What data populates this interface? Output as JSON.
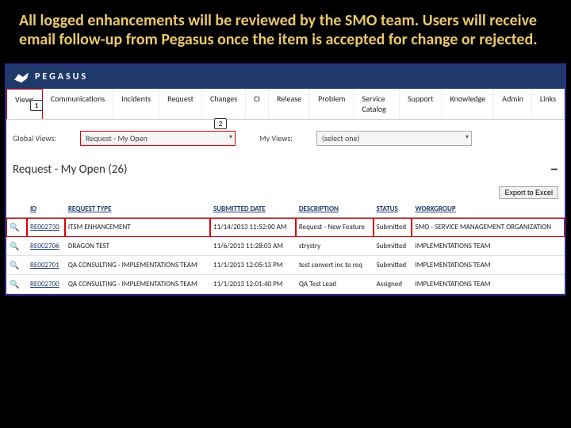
{
  "header": "All logged enhancements will be reviewed by the SMO team. Users will receive email follow-up from Pegasus once the item is accepted for change or rejected.",
  "brand": "PEGASUS",
  "tabs": [
    "Views",
    "Communications",
    "Incidents",
    "Request",
    "Changes",
    "CI",
    "Release",
    "Problem",
    "Service Catalog",
    "Support",
    "Knowledge",
    "Admin",
    "Links"
  ],
  "callouts": {
    "c1": "1",
    "c2": "2"
  },
  "filters": {
    "global_label": "Global Views:",
    "global_value": "Request - My Open",
    "my_label": "My Views:",
    "my_value": "(select one)"
  },
  "section": {
    "title": "Request - My Open",
    "count": "(26)"
  },
  "export_btn": "Export to Excel",
  "columns": [
    "",
    "ID",
    "REQUEST TYPE",
    "SUBMITTED DATE",
    "DESCRIPTION",
    "STATUS",
    "WORKGROUP"
  ],
  "rows": [
    {
      "id": "RE002730",
      "type": "ITSM ENHANCEMENT",
      "date": "11/14/2013 11:52:00 AM",
      "desc": "Request - New Feature",
      "status": "Submitted",
      "wg": "SMO - SERVICE MANAGEMENT ORGANIZATION",
      "hl": true
    },
    {
      "id": "RE002706",
      "type": "DRAGON TEST",
      "date": "11/6/2013 11:28:03 AM",
      "desc": "strystry",
      "status": "Submitted",
      "wg": "IMPLEMENTATIONS TEAM",
      "hl": false
    },
    {
      "id": "RE002701",
      "type": "QA CONSULTING - IMPLEMENTATIONS TEAM",
      "date": "11/1/2013 12:05:13 PM",
      "desc": "test convert inc to req",
      "status": "Submitted",
      "wg": "IMPLEMENTATIONS TEAM",
      "hl": false
    },
    {
      "id": "RE002700",
      "type": "QA CONSULTING - IMPLEMENTATIONS TEAM",
      "date": "11/1/2013 12:01:40 PM",
      "desc": "QA Test Lead",
      "status": "Assigned",
      "wg": "IMPLEMENTATIONS TEAM",
      "hl": false
    }
  ]
}
